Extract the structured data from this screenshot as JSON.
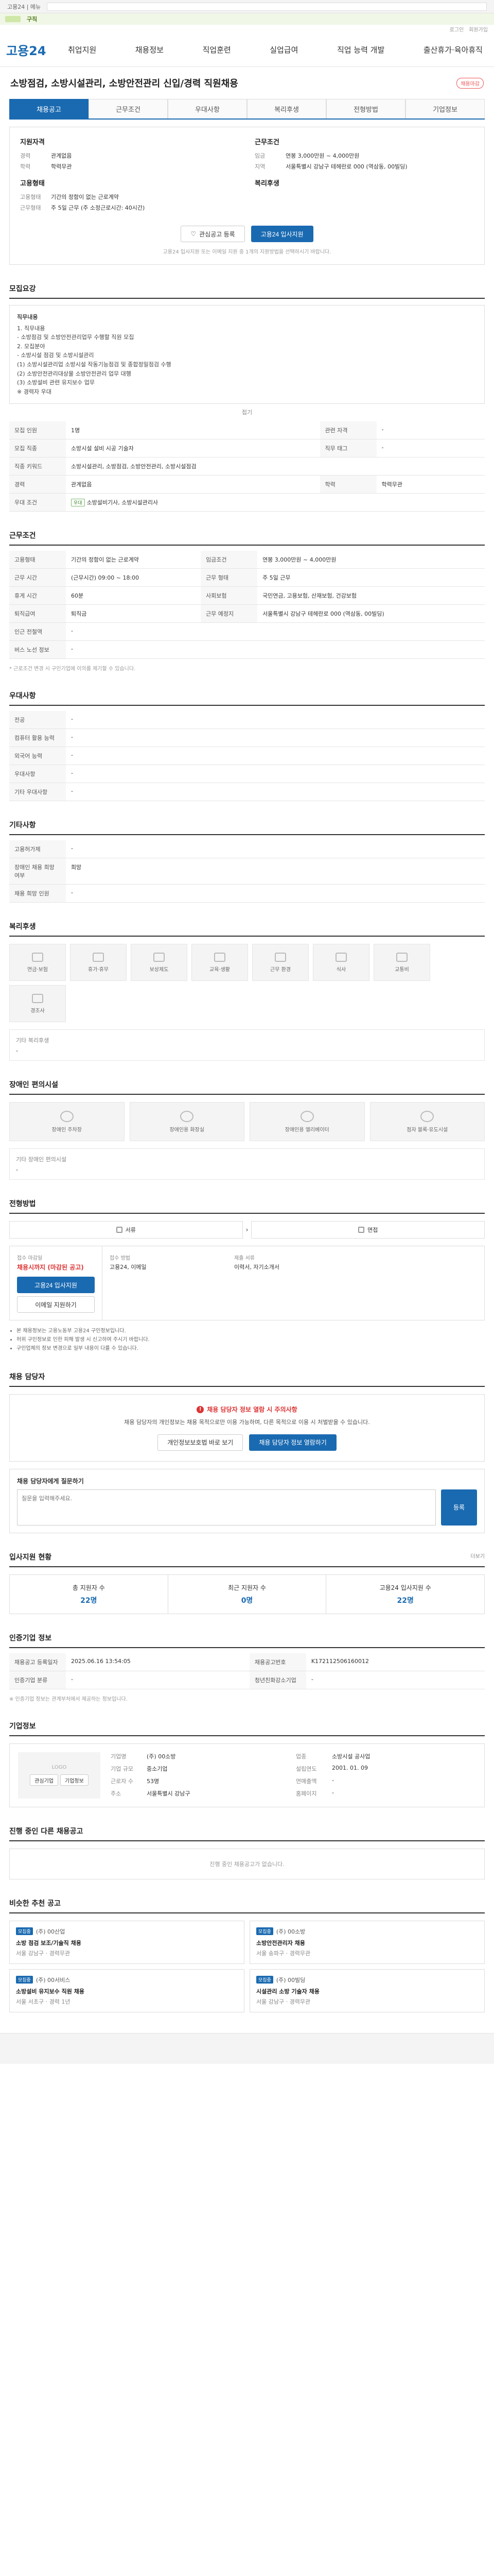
{
  "top": {
    "text": "고용24 | 메뉴",
    "label": "구직"
  },
  "status": {
    "a": "로그인",
    "b": "회원가입"
  },
  "header": {
    "logo": "고용24",
    "nav": [
      "취업지원",
      "채용정보",
      "직업훈련",
      "실업급여",
      "직업 능력 개발",
      "출산휴가·육아휴직"
    ]
  },
  "job": {
    "title": "소방점검, 소방시설관리, 소방안전관리 신입/경력 직원채용",
    "badge": "채용마감"
  },
  "tabs": [
    "채용공고",
    "근무조건",
    "우대사항",
    "복리후생",
    "전형방법",
    "기업정보"
  ],
  "summary": {
    "left_head": "지원자격",
    "left": [
      [
        "경력",
        "관계없음"
      ],
      [
        "학력",
        "학력무관"
      ]
    ],
    "left_head2": "고용형태",
    "left2": [
      [
        "고용형태",
        "기간의 정함이 없는 근로계약"
      ],
      [
        "근무형태",
        "주 5일 근무 (주 소정근로시간: 40시간)"
      ]
    ],
    "right_head": "근무조건",
    "right": [
      [
        "임금",
        "연봉 3,000만원 ~ 4,000만원"
      ],
      [
        "지역",
        "서울특별시 강남구 테헤란로 000 (역삼동, 00빌딩)"
      ]
    ],
    "right_head2": "복리후생",
    "save": "관심공고 등록",
    "apply": "고용24 입사지원",
    "note": "고용24 입사지원 또는 이메일 지원 중 1개의 지원방법을 선택하시기 바랍니다."
  },
  "sec_recruit": "모집요강",
  "recruit_text": {
    "head": "직무내용",
    "lines": [
      "1. 직무내용",
      "- 소방점검 및 소방안전관리업무 수행할 직원 모집",
      "2. 모집분야",
      "- 소방시설 점검 및 소방시설관리",
      "(1) 소방시설관리업 소방시설 작동기능점검 및 종합정밀점검 수행",
      "(2) 소방안전관리대상물 소방안전관리 업무 대행",
      "(3) 소방설비 관련 유지보수 업무",
      "※ 경력자 우대"
    ],
    "fold": "접기"
  },
  "recruit_table": [
    [
      "모집 인원",
      "1명",
      "관련 자격",
      "-"
    ],
    [
      "모집 직종",
      "소방시설 설비 시공 기술자",
      "직무 태그",
      "-"
    ],
    [
      "직종 키워드",
      "소방시설관리, 소방점검, 소방안전관리, 소방시설점검",
      "",
      ""
    ],
    [
      "경력",
      "관계없음",
      "학력",
      "학력무관"
    ],
    [
      "우대 조건",
      "소방설비기사, 소방시설관리사",
      "",
      ""
    ]
  ],
  "chips": [
    "우대",
    "우대"
  ],
  "sec_cond": "근무조건",
  "cond_table": [
    [
      "고용형태",
      "기간의 정함이 없는 근로계약",
      "임금조건",
      "연봉 3,000만원 ~ 4,000만원"
    ],
    [
      "근무 시간",
      "(근무시간) 09:00 ~ 18:00",
      "근무 형태",
      "주 5일 근무"
    ],
    [
      "휴게 시간",
      "60분",
      "사회보험",
      "국민연금, 고용보험, 산재보험, 건강보험"
    ],
    [
      "퇴직급여",
      "퇴직금",
      "근무 예정지",
      "서울특별시 강남구 테헤란로 000 (역삼동, 00빌딩)"
    ],
    [
      "인근 전철역",
      "-",
      "",
      ""
    ],
    [
      "버스 노선 정보",
      "-",
      "",
      ""
    ]
  ],
  "cond_note": "* 근로조건 변경 시 구인기업에 이의를 제기할 수 있습니다.",
  "sec_pref": "우대사항",
  "pref_table": [
    [
      "전공",
      "-"
    ],
    [
      "컴퓨터 활용 능력",
      "-"
    ],
    [
      "외국어 능력",
      "-"
    ],
    [
      "우대사항",
      "-"
    ],
    [
      "기타 우대사항",
      "-"
    ]
  ],
  "sec_etc": "기타사항",
  "etc_table": [
    [
      "고용허가제",
      "-"
    ],
    [
      "장애인 채용 희망 여부",
      "희망"
    ],
    [
      "채용 희망 인원",
      "-"
    ]
  ],
  "sec_benefit": "복리후생",
  "benefits": [
    "연금·보험",
    "휴가·휴무",
    "보상제도",
    "교육·생활",
    "근무 환경",
    "식사",
    "교통비",
    "경조사"
  ],
  "benefit_etc": {
    "h": "기타 복리후생",
    "v": "-"
  },
  "sec_facility": "장애인 편의시설",
  "facilities": [
    "장애인 주차장",
    "장애인용 화장실",
    "장애인용 엘리베이터",
    "점자 블록·유도시설"
  ],
  "facility_etc": {
    "h": "기타 장애인 편의시설",
    "v": "-"
  },
  "sec_proc": "전형방법",
  "proc": [
    "서류",
    "면접"
  ],
  "apply": {
    "lbl1": "접수 마감일",
    "deadline": "채용시까지 (마감된 공고)",
    "lbl2": "접수 방법",
    "method": "고용24, 이메일",
    "lbl3": "제출 서류",
    "docs": "이력서, 자기소개서",
    "btn": "고용24 입사지원",
    "btn2": "이메일 지원하기"
  },
  "notes": [
    "본 채용정보는 고용노동부 고용24 구인정보입니다.",
    "허위 구인정보로 인한 피해 발생 시 신고하여 주시기 바랍니다.",
    "구인업체의 정보 변경으로 일부 내용이 다를 수 있습니다."
  ],
  "sec_contact": "채용 담당자",
  "contact": {
    "warn": "채용 담당자 정보 열람 시 주의사항",
    "p": "채용 담당자의 개인정보는 채용 목적으로만 이용 가능하며, 다른 목적으로 이용 시 처벌받을 수 있습니다.",
    "b1": "개인정보보호법 바로 보기",
    "b2": "채용 담당자 정보 열람하기"
  },
  "qa": {
    "title": "채용 담당자에게 질문하기",
    "placeholder": "질문을 입력해주세요.",
    "btn": "등록"
  },
  "sec_stats": "입사지원 현황",
  "stat_more": "더보기",
  "stats": [
    [
      "총 지원자 수",
      "22명"
    ],
    [
      "최근 지원자 수",
      "0명"
    ],
    [
      "고용24 입사지원 수",
      "22명"
    ]
  ],
  "sec_info": "인증기업 정보",
  "info_table": [
    [
      "채용공고 등록일자",
      "2025.06.16 13:54:05",
      "채용공고번호",
      "K172112506160012"
    ],
    [
      "인증기업 분류",
      "-",
      "청년친화강소기업",
      "-"
    ]
  ],
  "info_note": "※ 인증기업 정보는 관계부처에서 제공하는 정보입니다.",
  "sec_company": "기업정보",
  "company": {
    "logo": "LOGO",
    "b1": "관심기업",
    "b2": "기업정보",
    "rows": [
      [
        "기업명",
        "(주) 00소방",
        "업종",
        "소방시설 공사업"
      ],
      [
        "기업 규모",
        "중소기업",
        "설립연도",
        "2001. 01. 09"
      ],
      [
        "근로자 수",
        "53명",
        "연매출액",
        "-"
      ],
      [
        "주소",
        "서울특별시 강남구",
        "홈페이지",
        "-"
      ]
    ]
  },
  "sec_recent": "진행 중인 다른 채용공고",
  "recent_empty": "진행 중인 채용공고가 없습니다.",
  "sec_similar": "비슷한 추천 공고",
  "similar": [
    {
      "co": "(주) 00산업",
      "tag": "모집중",
      "t": "소방 점검 보조/기술직 채용",
      "m": "서울 강남구 · 경력무관"
    },
    {
      "co": "(주) 00소방",
      "tag": "모집중",
      "t": "소방안전관리자 채용",
      "m": "서울 송파구 · 경력무관"
    },
    {
      "co": "(주) 00서비스",
      "tag": "모집중",
      "t": "소방설비 유지보수 직원 채용",
      "m": "서울 서초구 · 경력 1년"
    },
    {
      "co": "(주) 00빌딩",
      "tag": "모집중",
      "t": "시설관리 소방 기술자 채용",
      "m": "서울 강남구 · 경력무관"
    }
  ]
}
